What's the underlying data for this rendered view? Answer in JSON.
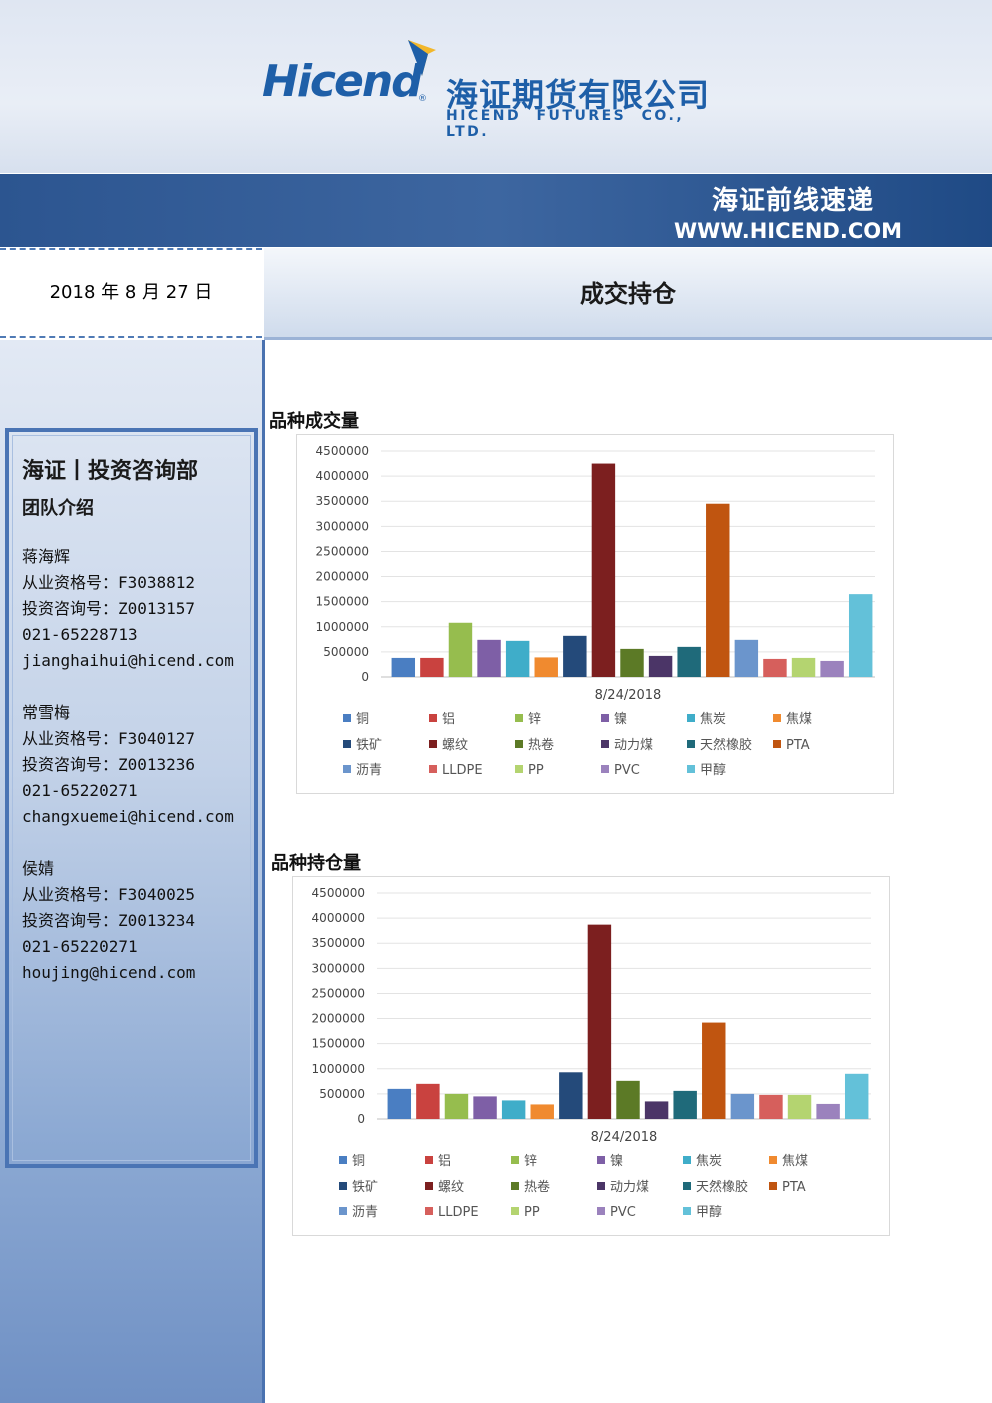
{
  "header": {
    "logo_en": "Hicend",
    "logo_cn": "海证期货有限公司",
    "logo_sub": "HICEND FUTURES CO., LTD.",
    "band_title": "海证前线速递",
    "band_url": "WWW.HICEND.COM"
  },
  "date": "2018 年 8 月 27 日",
  "page_title": "成交持仓",
  "team": {
    "heading": "海证丨投资咨询部",
    "subheading": "团队介绍",
    "members": [
      {
        "name": "蒋海辉",
        "qual": "从业资格号：F3038812",
        "consult": "投资咨询号：Z0013157",
        "phone": "021-65228713",
        "email": "jianghaihui@hicend.com"
      },
      {
        "name": "常雪梅",
        "qual": "从业资格号：F3040127",
        "consult": "投资咨询号：Z0013236",
        "phone": "021-65220271",
        "email": "changxuemei@hicend.com"
      },
      {
        "name": "侯婧",
        "qual": "从业资格号：F3040025",
        "consult": "投资咨询号：Z0013234",
        "phone": "021-65220271",
        "email": "houjing@hicend.com"
      }
    ]
  },
  "series_names": [
    "铜",
    "铝",
    "锌",
    "镍",
    "焦炭",
    "焦煤",
    "铁矿",
    "螺纹",
    "热卷",
    "动力煤",
    "天然橡胶",
    "PTA",
    "沥青",
    "LLDPE",
    "PP",
    "PVC",
    "甲醇"
  ],
  "colors": [
    "#4a7ec2",
    "#c9423f",
    "#96bd4e",
    "#7e5fa6",
    "#3fadc9",
    "#f08a2f",
    "#244a7a",
    "#7c1f1f",
    "#5c7a26",
    "#4b3567",
    "#1f6a7a",
    "#c05510",
    "#6b95cc",
    "#d65f5c",
    "#b4d470",
    "#9b82bd",
    "#63c1d9"
  ],
  "chart_data": [
    {
      "type": "bar",
      "title": "品种成交量",
      "categories": [
        "8/24/2018"
      ],
      "ylim": [
        0,
        4500000
      ],
      "yticks": [
        0,
        500000,
        1000000,
        1500000,
        2000000,
        2500000,
        3000000,
        3500000,
        4000000,
        4500000
      ],
      "series": [
        {
          "name": "铜",
          "values": [
            380000
          ]
        },
        {
          "name": "铝",
          "values": [
            380000
          ]
        },
        {
          "name": "锌",
          "values": [
            1080000
          ]
        },
        {
          "name": "镍",
          "values": [
            740000
          ]
        },
        {
          "name": "焦炭",
          "values": [
            720000
          ]
        },
        {
          "name": "焦煤",
          "values": [
            390000
          ]
        },
        {
          "name": "铁矿",
          "values": [
            820000
          ]
        },
        {
          "name": "螺纹",
          "values": [
            4250000
          ]
        },
        {
          "name": "热卷",
          "values": [
            560000
          ]
        },
        {
          "name": "动力煤",
          "values": [
            420000
          ]
        },
        {
          "name": "天然橡胶",
          "values": [
            600000
          ]
        },
        {
          "name": "PTA",
          "values": [
            3450000
          ]
        },
        {
          "name": "沥青",
          "values": [
            740000
          ]
        },
        {
          "name": "LLDPE",
          "values": [
            360000
          ]
        },
        {
          "name": "PP",
          "values": [
            380000
          ]
        },
        {
          "name": "PVC",
          "values": [
            320000
          ]
        },
        {
          "name": "甲醇",
          "values": [
            1650000
          ]
        }
      ],
      "legend": "bottom",
      "grid": true
    },
    {
      "type": "bar",
      "title": "品种持仓量",
      "categories": [
        "8/24/2018"
      ],
      "ylim": [
        0,
        4500000
      ],
      "yticks": [
        0,
        500000,
        1000000,
        1500000,
        2000000,
        2500000,
        3000000,
        3500000,
        4000000,
        4500000
      ],
      "series": [
        {
          "name": "铜",
          "values": [
            600000
          ]
        },
        {
          "name": "铝",
          "values": [
            700000
          ]
        },
        {
          "name": "锌",
          "values": [
            500000
          ]
        },
        {
          "name": "镍",
          "values": [
            450000
          ]
        },
        {
          "name": "焦炭",
          "values": [
            370000
          ]
        },
        {
          "name": "焦煤",
          "values": [
            290000
          ]
        },
        {
          "name": "铁矿",
          "values": [
            930000
          ]
        },
        {
          "name": "螺纹",
          "values": [
            3870000
          ]
        },
        {
          "name": "热卷",
          "values": [
            760000
          ]
        },
        {
          "name": "动力煤",
          "values": [
            350000
          ]
        },
        {
          "name": "天然橡胶",
          "values": [
            560000
          ]
        },
        {
          "name": "PTA",
          "values": [
            1920000
          ]
        },
        {
          "name": "沥青",
          "values": [
            500000
          ]
        },
        {
          "name": "LLDPE",
          "values": [
            480000
          ]
        },
        {
          "name": "PP",
          "values": [
            480000
          ]
        },
        {
          "name": "PVC",
          "values": [
            300000
          ]
        },
        {
          "name": "甲醇",
          "values": [
            900000
          ]
        }
      ],
      "legend": "bottom",
      "grid": true
    }
  ]
}
